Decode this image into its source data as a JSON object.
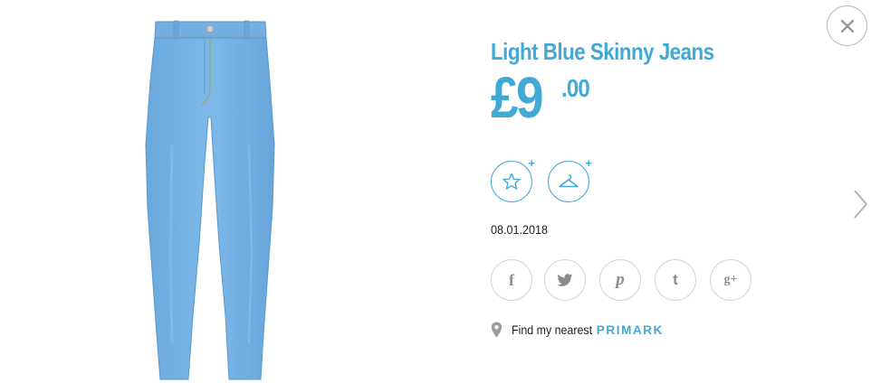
{
  "product": {
    "title": "Light Blue Skinny Jeans",
    "price_currency_whole": "£9",
    "price_decimals": ".00",
    "date": "08.01.2018",
    "image_icon": "light-blue-skinny-jeans"
  },
  "actions": [
    {
      "icon": "star-icon"
    },
    {
      "icon": "hanger-icon"
    }
  ],
  "social": [
    {
      "icon": "facebook-icon",
      "glyph": "f"
    },
    {
      "icon": "twitter-icon",
      "glyph": "t"
    },
    {
      "icon": "pinterest-icon",
      "glyph": "p"
    },
    {
      "icon": "tumblr-icon",
      "glyph": "t"
    },
    {
      "icon": "google-plus-icon",
      "glyph": "g+"
    }
  ],
  "store_finder": {
    "label": "Find my nearest",
    "brand": "PRIMARK"
  },
  "colors": {
    "accent": "#41a9d6",
    "denim": "#74b1e2"
  }
}
